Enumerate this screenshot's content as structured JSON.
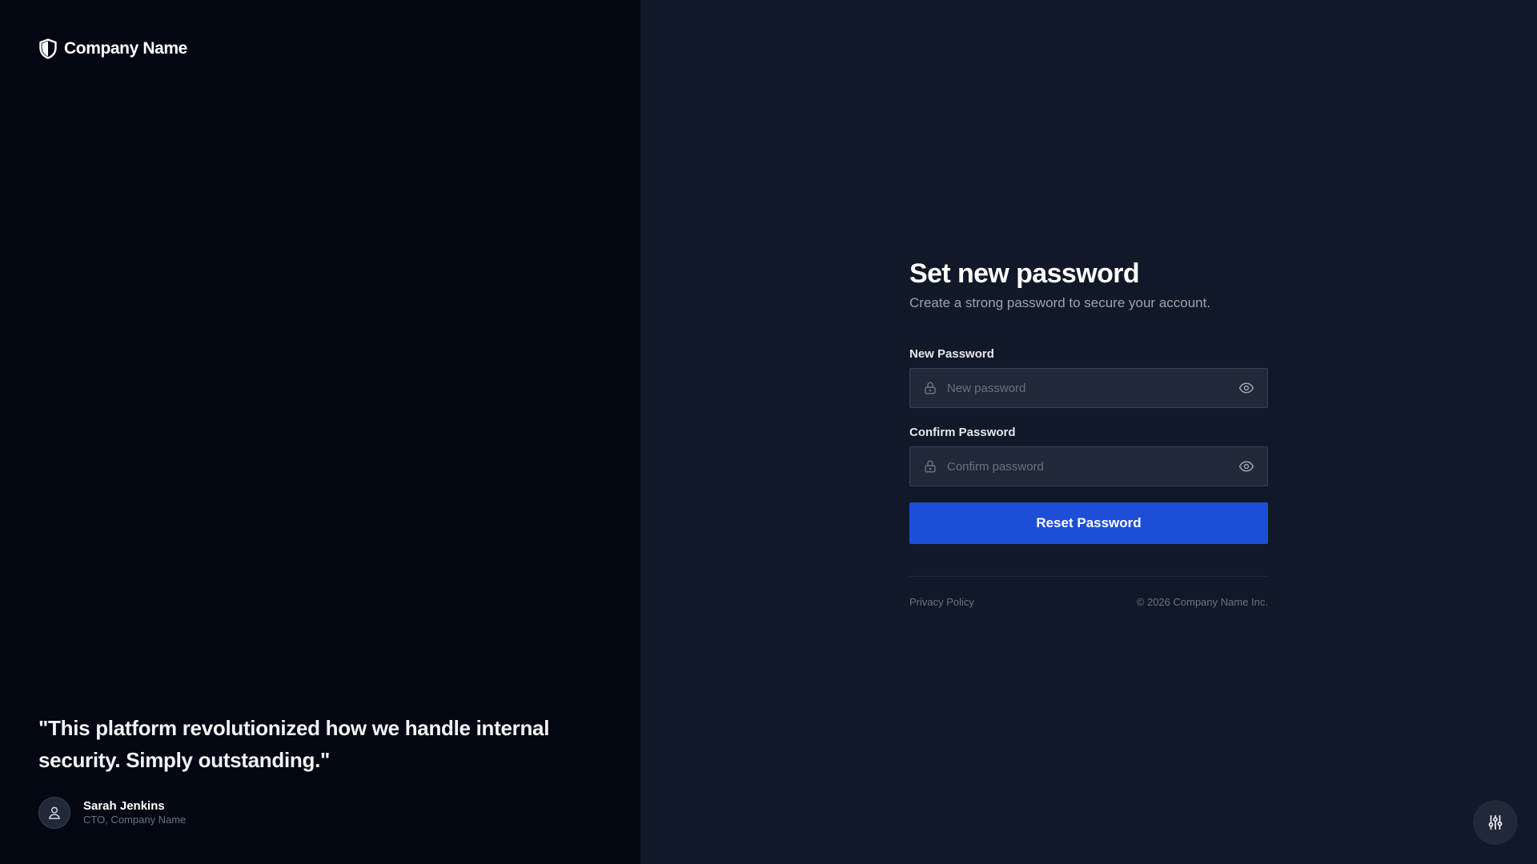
{
  "brand": {
    "name": "Company Name",
    "icon": "shield-icon"
  },
  "testimonial": {
    "quote": "\"This platform revolutionized how we handle internal security. Simply outstanding.\"",
    "author_name": "Sarah Jenkins",
    "author_role": "CTO, Company Name",
    "avatar_icon": "user-icon"
  },
  "form": {
    "title": "Set new password",
    "subtitle": "Create a strong password to secure your account.",
    "new_password": {
      "label": "New Password",
      "placeholder": "New password",
      "value": "",
      "icon": "lock-icon",
      "toggle_icon": "eye-icon"
    },
    "confirm_password": {
      "label": "Confirm Password",
      "placeholder": "Confirm password",
      "value": "",
      "icon": "lock-icon",
      "toggle_icon": "eye-icon"
    },
    "submit_label": "Reset Password"
  },
  "footer": {
    "privacy_link": "Privacy Policy",
    "copyright": "© 2026 Company Name Inc."
  },
  "settings": {
    "icon": "sliders-icon"
  },
  "colors": {
    "left_panel_bg": "#030712",
    "right_panel_bg": "#111827",
    "accent": "#1d4ed8",
    "input_bg": "#1f2937",
    "input_border": "#374151",
    "muted_text": "#6b7280"
  }
}
